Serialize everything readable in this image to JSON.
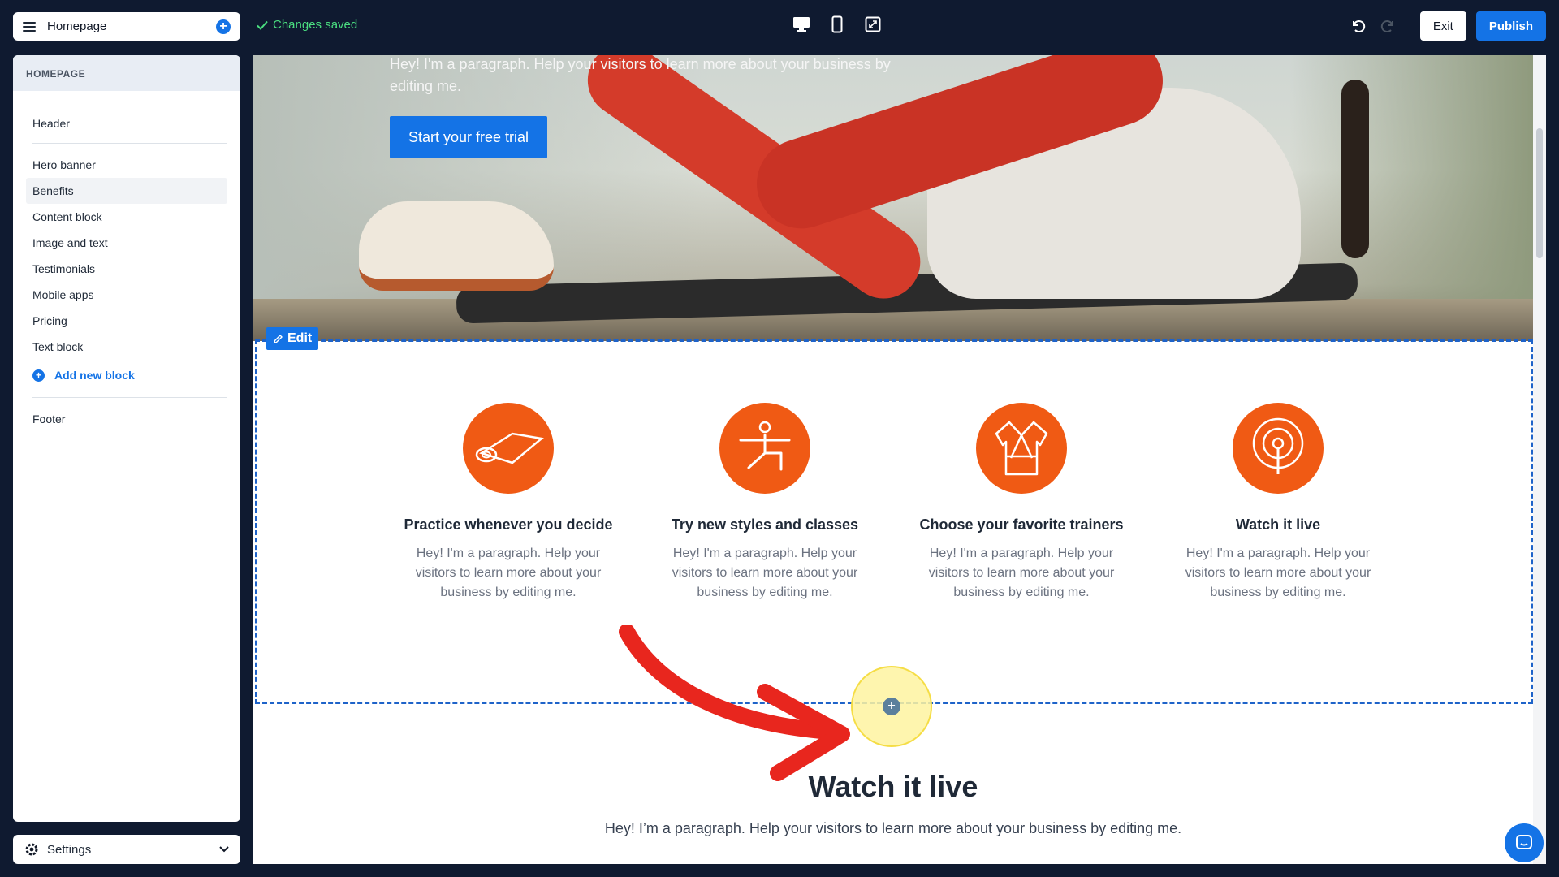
{
  "topbar": {
    "page_name": "Homepage",
    "save_status": "Changes saved",
    "exit_label": "Exit",
    "publish_label": "Publish",
    "device_icons": [
      "desktop-icon",
      "mobile-icon",
      "fullscreen-icon"
    ]
  },
  "sidebar": {
    "heading": "HOMEPAGE",
    "header_item": "Header",
    "items": [
      {
        "label": "Hero banner"
      },
      {
        "label": "Benefits",
        "active": true
      },
      {
        "label": "Content block"
      },
      {
        "label": "Image and text"
      },
      {
        "label": "Testimonials"
      },
      {
        "label": "Mobile apps"
      },
      {
        "label": "Pricing"
      },
      {
        "label": "Text block"
      }
    ],
    "add_block_label": "Add new block",
    "footer_item": "Footer",
    "settings_label": "Settings"
  },
  "hero": {
    "paragraph": "Hey! I'm a paragraph. Help your visitors to learn more about your business by editing me.",
    "cta_label": "Start your free trial"
  },
  "benefits": {
    "edit_label": "Edit",
    "features": [
      {
        "icon": "yoga-mat-icon",
        "title": "Practice whenever you decide",
        "text": "Hey! I'm a paragraph. Help your visitors to learn more about your business by editing me."
      },
      {
        "icon": "yoga-pose-icon",
        "title": "Try new styles and classes",
        "text": "Hey! I'm a paragraph. Help your visitors to learn more about your business by editing me."
      },
      {
        "icon": "martial-arts-uniform-icon",
        "title": "Choose your favorite trainers",
        "text": "Hey! I'm a paragraph. Help your visitors to learn more about your business by editing me."
      },
      {
        "icon": "broadcast-icon",
        "title": "Watch it live",
        "text": "Hey! I'm a paragraph. Help your visitors to learn more about your business by editing me."
      }
    ]
  },
  "watch_section": {
    "title": "Watch it live",
    "paragraph": "Hey! I’m a paragraph. Help your visitors to learn more about your business by editing me."
  },
  "colors": {
    "accent": "#1473e6",
    "feature_orange": "#f05a14",
    "topbar_bg": "#0f1a30",
    "saved_green": "#4ade80",
    "annotation_red": "#e8261e"
  }
}
